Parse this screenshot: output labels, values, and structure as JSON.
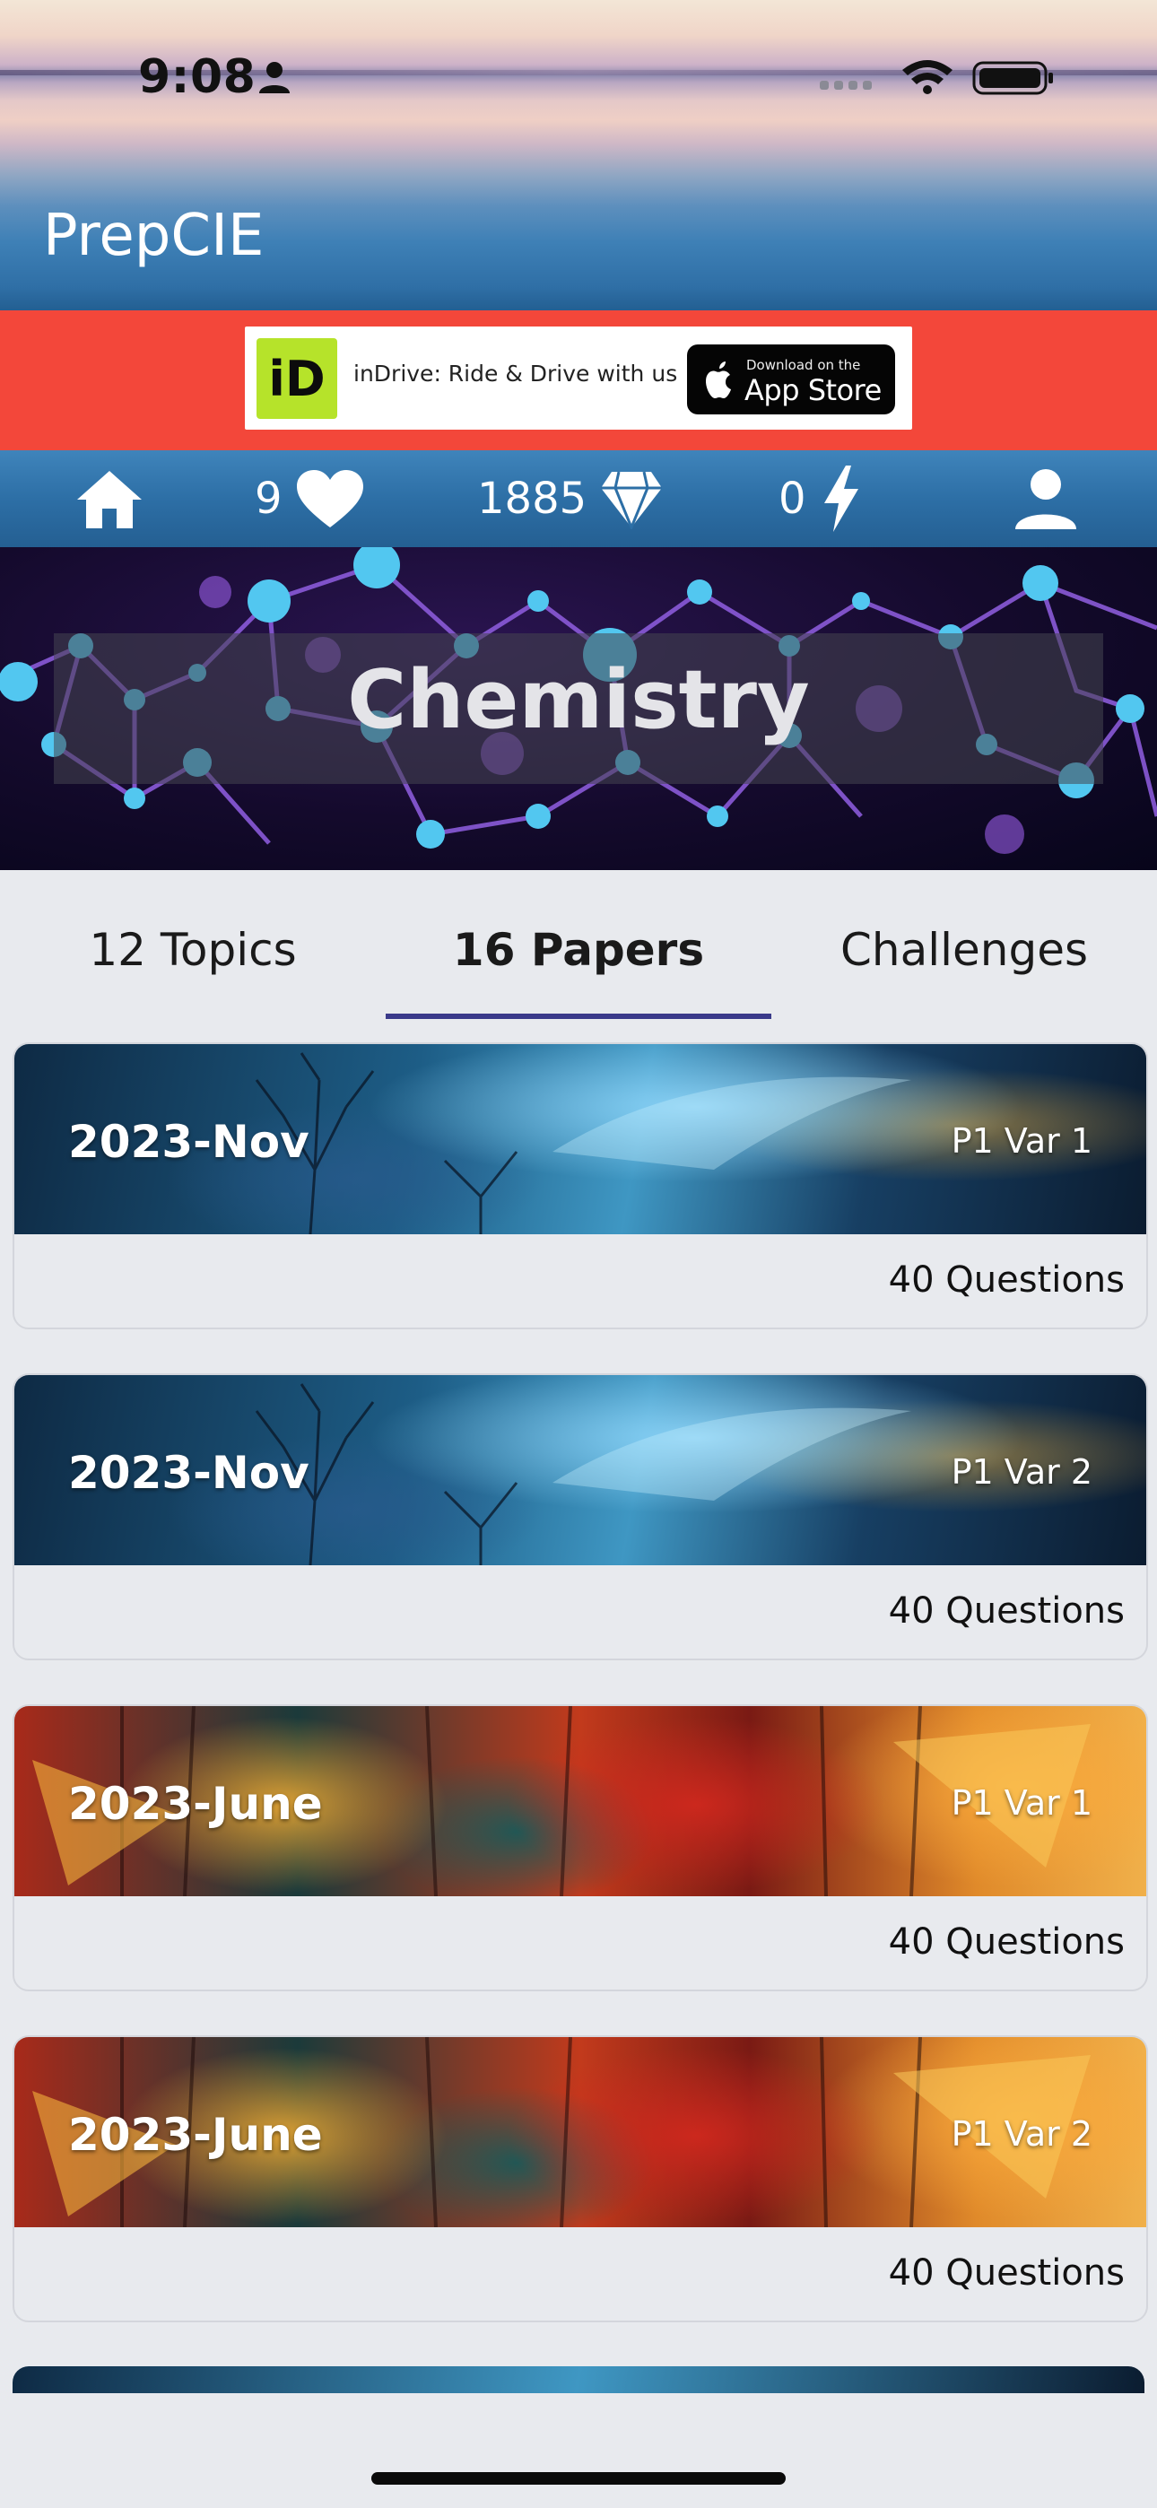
{
  "status_bar": {
    "time": "9:08"
  },
  "app": {
    "title": "PrepCIE"
  },
  "ad": {
    "logo_text": "iD",
    "text": "inDrive: Ride & Drive with us",
    "store_small": "Download on the",
    "store_big": "App Store"
  },
  "stats": {
    "lives": "9",
    "gems": "1885",
    "energy": "0"
  },
  "hero": {
    "subject": "Chemistry"
  },
  "tabs": [
    {
      "label": "12 Topics"
    },
    {
      "label": "16 Papers"
    },
    {
      "label": "Challenges"
    }
  ],
  "active_tab": "16 Papers",
  "papers": [
    {
      "session": "2023-Nov",
      "variant": "P1 Var 1",
      "questions": "40 Questions"
    },
    {
      "session": "2023-Nov",
      "variant": "P1 Var 2",
      "questions": "40 Questions"
    },
    {
      "session": "2023-June",
      "variant": "P1 Var 1",
      "questions": "40 Questions"
    },
    {
      "session": "2023-June",
      "variant": "P1 Var 2",
      "questions": "40 Questions"
    }
  ],
  "icons": {
    "home": "home-icon",
    "lives": "heart-icon",
    "gems": "diamond-icon",
    "energy": "lightning-icon",
    "profile": "profile-icon"
  },
  "colors": {
    "ad_background": "#f3473a",
    "stat_bar": "#2d6fa6",
    "tab_underline": "#3a3a8a",
    "page_background": "#e8eaee"
  }
}
